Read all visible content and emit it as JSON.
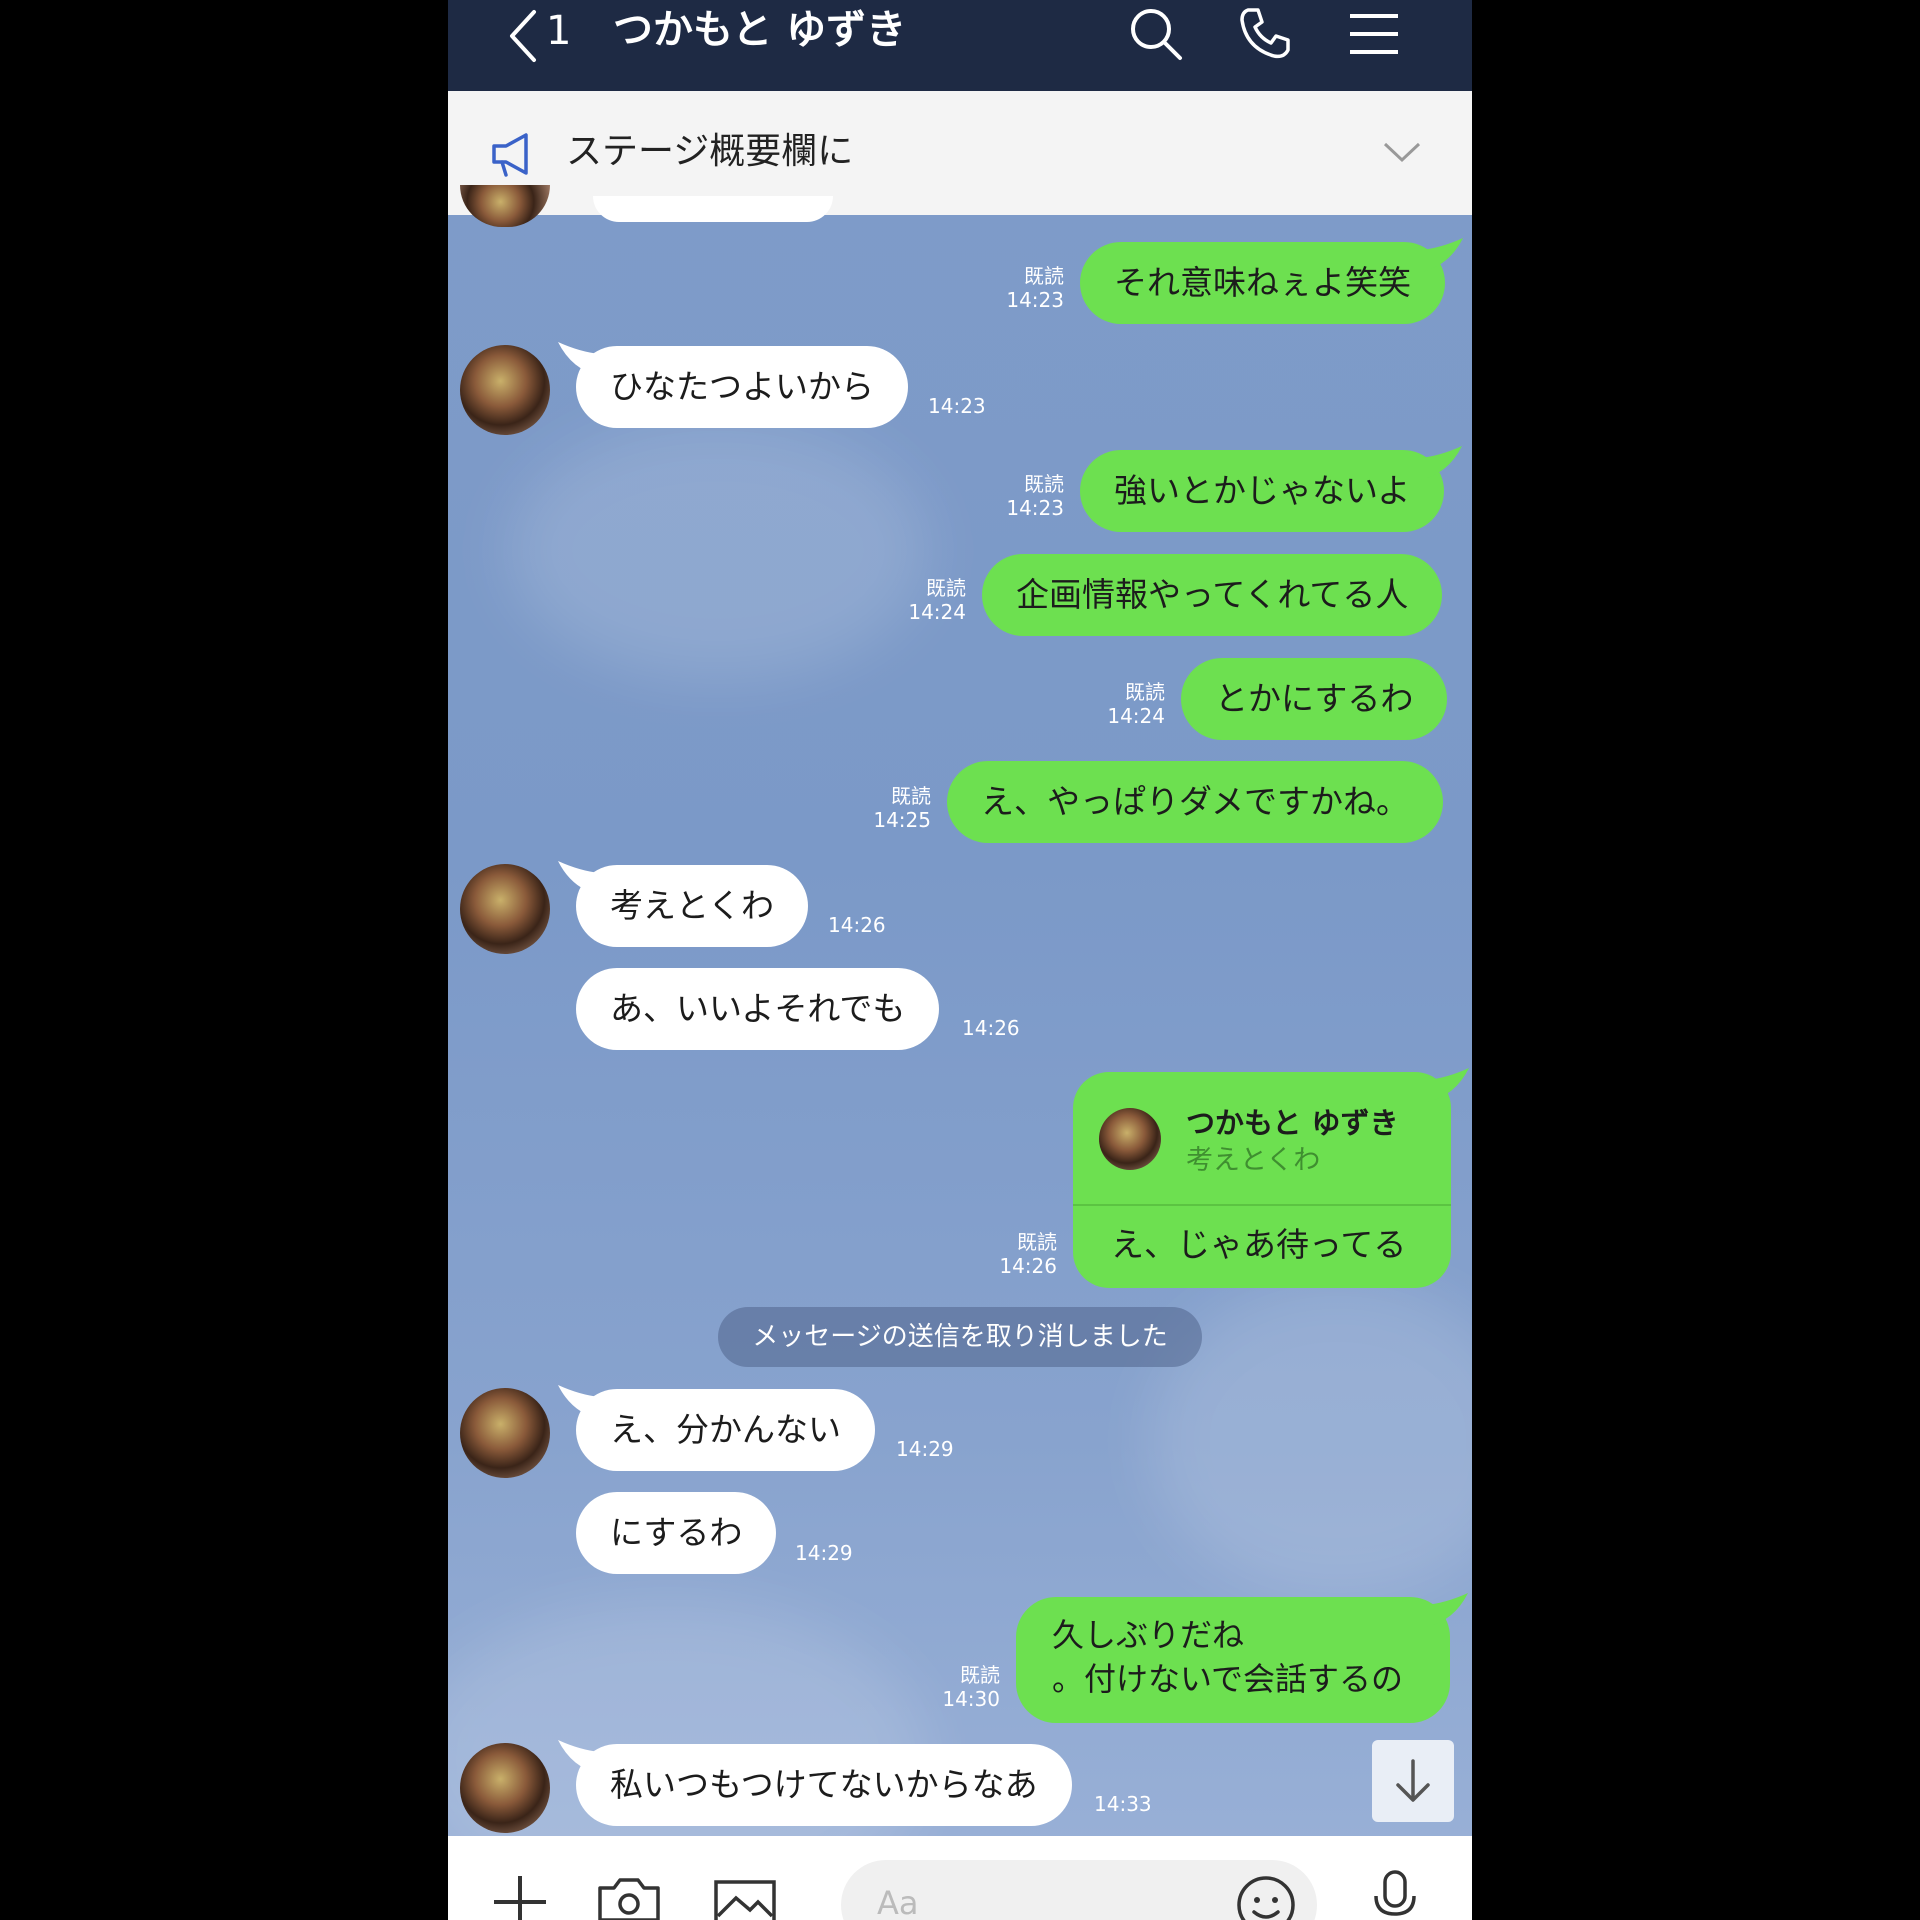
{
  "header": {
    "back_count": "1",
    "title": "つかもと ゆずき"
  },
  "announcement": {
    "text": "ステージ概要欄に"
  },
  "messages": [
    {
      "side": "out",
      "text": "それ意味ねぇよ笑笑",
      "read": "既読",
      "time": "14:23"
    },
    {
      "side": "in",
      "text": "ひなたつよいから",
      "time": "14:23"
    },
    {
      "side": "out",
      "text": "強いとかじゃないよ",
      "read": "既読",
      "time": "14:23"
    },
    {
      "side": "out",
      "text": "企画情報やってくれてる人",
      "read": "既読",
      "time": "14:24"
    },
    {
      "side": "out",
      "text": "とかにするわ",
      "read": "既読",
      "time": "14:24"
    },
    {
      "side": "out",
      "text": "え、やっぱりダメですかね。",
      "read": "既読",
      "time": "14:25"
    },
    {
      "side": "in",
      "text": "考えとくわ",
      "time": "14:26"
    },
    {
      "side": "in",
      "text": "あ、いいよそれでも",
      "time": "14:26"
    },
    {
      "side": "out",
      "reply_name": "つかもと ゆずき",
      "reply_quote": "考えとくわ",
      "text": "え、じゃあ待ってる",
      "read": "既読",
      "time": "14:26"
    },
    {
      "side": "in",
      "text": "え、分かんない",
      "time": "14:29"
    },
    {
      "side": "in",
      "text": "にするわ",
      "time": "14:29"
    },
    {
      "side": "out",
      "line1": "久しぶりだね",
      "line2": "。付けないで会話するの",
      "read": "既読",
      "time": "14:30"
    },
    {
      "side": "in",
      "text": "私いつもつけてないからなあ",
      "time": "14:33"
    }
  ],
  "system_message": "メッセージの送信を取り消しました",
  "input": {
    "placeholder": "Aa"
  },
  "colors": {
    "header_bg": "#1e2a44",
    "outgoing_bubble": "#6de050",
    "incoming_bubble": "#ffffff",
    "chat_bg": "#7f9cc9"
  },
  "icons": [
    "chevron-left-icon",
    "search-icon",
    "phone-icon",
    "menu-icon",
    "megaphone-icon",
    "chevron-down-icon",
    "arrow-down-icon",
    "plus-icon",
    "camera-icon",
    "image-icon",
    "emoji-icon",
    "mic-icon"
  ]
}
